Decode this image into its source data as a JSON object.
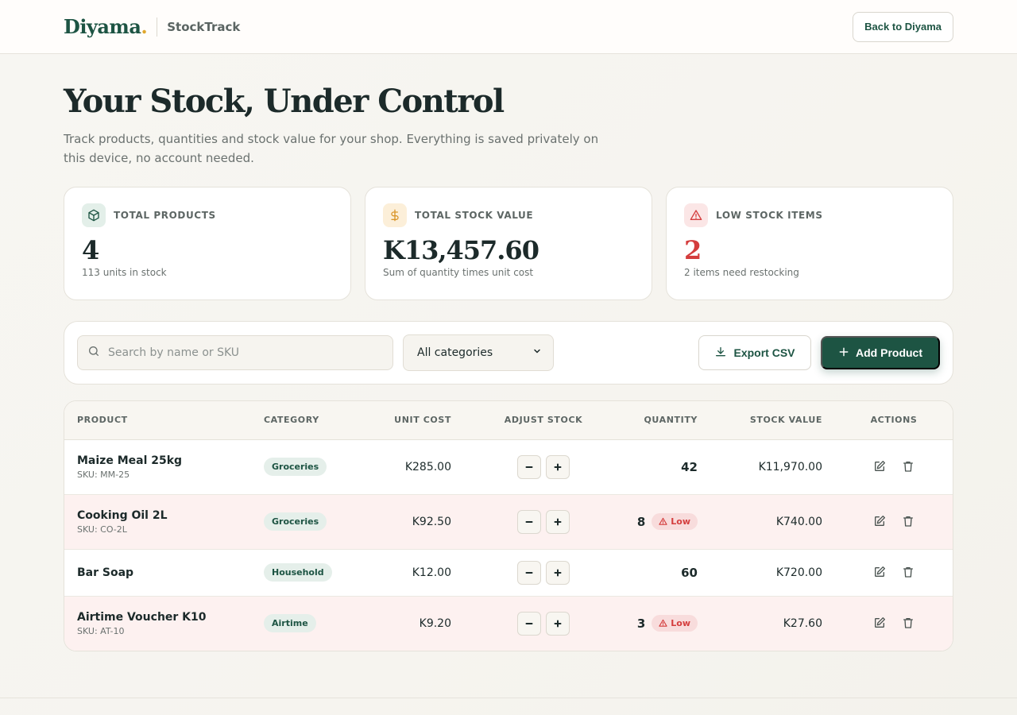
{
  "header": {
    "logo": "Diyama",
    "logo_dot": ".",
    "app_name": "StockTrack",
    "back_label": "Back to Diyama"
  },
  "hero": {
    "title": "Your Stock, Under Control",
    "subtitle": "Track products, quantities and stock value for your shop. Everything is saved privately on this device, no account needed."
  },
  "stats": [
    {
      "icon": "box-icon",
      "label": "TOTAL PRODUCTS",
      "value": "4",
      "note": "113 units in stock"
    },
    {
      "icon": "dollar-icon",
      "label": "TOTAL STOCK VALUE",
      "value": "K13,457.60",
      "note": "Sum of quantity times unit cost"
    },
    {
      "icon": "warning-icon",
      "label": "LOW STOCK ITEMS",
      "value": "2",
      "note": "2 items need restocking"
    }
  ],
  "toolbar": {
    "search_placeholder": "Search by name or SKU",
    "category_selected": "All categories",
    "export_label": "Export CSV",
    "add_label": "Add Product"
  },
  "table": {
    "columns": [
      "PRODUCT",
      "CATEGORY",
      "UNIT COST",
      "ADJUST STOCK",
      "QUANTITY",
      "STOCK VALUE",
      "ACTIONS"
    ],
    "low_label": "Low",
    "rows": [
      {
        "name": "Maize Meal 25kg",
        "sku": "SKU: MM-25",
        "category": "Groceries",
        "unit_cost": "K285.00",
        "quantity": "42",
        "value": "K11,970.00",
        "low": false
      },
      {
        "name": "Cooking Oil 2L",
        "sku": "SKU: CO-2L",
        "category": "Groceries",
        "unit_cost": "K92.50",
        "quantity": "8",
        "value": "K740.00",
        "low": true
      },
      {
        "name": "Bar Soap",
        "sku": "",
        "category": "Household",
        "unit_cost": "K12.00",
        "quantity": "60",
        "value": "K720.00",
        "low": false
      },
      {
        "name": "Airtime Voucher K10",
        "sku": "SKU: AT-10",
        "category": "Airtime",
        "unit_cost": "K9.20",
        "quantity": "3",
        "value": "K27.60",
        "low": true
      }
    ]
  },
  "colors": {
    "brand": "#1d5443",
    "accent": "#e0a82e",
    "danger": "#d43d3d"
  }
}
